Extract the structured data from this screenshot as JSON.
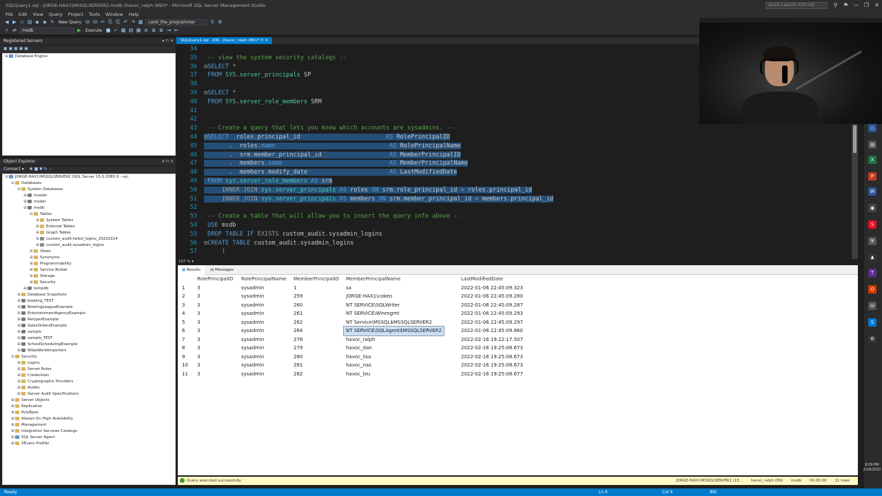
{
  "window": {
    "title": "SQLQuery1.sql - JORGE-HAX1\\MSSQLSERVER2.msdb (havoc_ralph (89))* - Microsoft SQL Server Management Studio",
    "quick_launch_placeholder": "Quick Launch (Ctrl+Q)",
    "buttons": [
      "⚲",
      "⚑",
      "—",
      "❐",
      "✕"
    ]
  },
  "menu": [
    "File",
    "Edit",
    "View",
    "Query",
    "Project",
    "Tools",
    "Window",
    "Help"
  ],
  "toolbar": {
    "new_query": "New Query",
    "database": "msdb",
    "execute": "Execute",
    "login": "carol_the_programmer"
  },
  "registered_servers": {
    "title": "Registered Servers",
    "pin_buttons": "▾ ⊓ ✕",
    "items": [
      {
        "label": "Database Engine"
      }
    ]
  },
  "object_explorer": {
    "title": "Object Explorer",
    "pin_buttons": "▾ ⊓ ✕",
    "connect_label": "Connect ▾",
    "nodes": [
      {
        "label": "JORGE-HAX1\\MSSQLSERVER2 (SQL Server 15.0.2080.9 - sa)",
        "exp": "⊟",
        "icon": "server",
        "indent": 0
      },
      {
        "label": "Databases",
        "exp": "⊟",
        "icon": "folder",
        "indent": 1
      },
      {
        "label": "System Databases",
        "exp": "⊟",
        "icon": "folder",
        "indent": 2
      },
      {
        "label": "master",
        "exp": "⊞",
        "icon": "db",
        "indent": 3
      },
      {
        "label": "model",
        "exp": "⊞",
        "icon": "db",
        "indent": 3
      },
      {
        "label": "msdb",
        "exp": "⊟",
        "icon": "db",
        "indent": 3
      },
      {
        "label": "Tables",
        "exp": "⊟",
        "icon": "folder",
        "indent": 4
      },
      {
        "label": "System Tables",
        "exp": "⊞",
        "icon": "folder",
        "indent": 5
      },
      {
        "label": "External Tables",
        "exp": "⊞",
        "icon": "folder",
        "indent": 5
      },
      {
        "label": "Graph Tables",
        "exp": "⊞",
        "icon": "folder",
        "indent": 5
      },
      {
        "label": "custom_audit.failed_logins_20220214",
        "exp": "⊞",
        "icon": "table",
        "indent": 5
      },
      {
        "label": "custom_audit.sysadmin_logins",
        "exp": "⊞",
        "icon": "table",
        "indent": 5
      },
      {
        "label": "Views",
        "exp": "⊞",
        "icon": "folder",
        "indent": 4
      },
      {
        "label": "Synonyms",
        "exp": "⊞",
        "icon": "folder",
        "indent": 4
      },
      {
        "label": "Programmability",
        "exp": "⊞",
        "icon": "folder",
        "indent": 4
      },
      {
        "label": "Service Broker",
        "exp": "⊞",
        "icon": "folder",
        "indent": 4
      },
      {
        "label": "Storage",
        "exp": "⊞",
        "icon": "folder",
        "indent": 4
      },
      {
        "label": "Security",
        "exp": "⊞",
        "icon": "folder",
        "indent": 4
      },
      {
        "label": "tempdb",
        "exp": "⊞",
        "icon": "db",
        "indent": 3
      },
      {
        "label": "Database Snapshots",
        "exp": "⊞",
        "icon": "folder",
        "indent": 2
      },
      {
        "label": "bowling_TEST",
        "exp": "⊞",
        "icon": "db",
        "indent": 2
      },
      {
        "label": "BowlingLeagueExample",
        "exp": "⊞",
        "icon": "db",
        "indent": 2
      },
      {
        "label": "EntertainmentAgencyExample",
        "exp": "⊞",
        "icon": "db",
        "indent": 2
      },
      {
        "label": "RecipesExample",
        "exp": "⊞",
        "icon": "db",
        "indent": 2
      },
      {
        "label": "SalesOrdersExample",
        "exp": "⊞",
        "icon": "db",
        "indent": 2
      },
      {
        "label": "sample",
        "exp": "⊞",
        "icon": "db",
        "indent": 2
      },
      {
        "label": "sample_TEST",
        "exp": "⊞",
        "icon": "db",
        "indent": 2
      },
      {
        "label": "SchoolSchedulingExample",
        "exp": "⊞",
        "icon": "db",
        "indent": 2
      },
      {
        "label": "WideWorldImporters",
        "exp": "⊞",
        "icon": "db",
        "indent": 2
      },
      {
        "label": "Security",
        "exp": "⊟",
        "icon": "folder",
        "indent": 1
      },
      {
        "label": "Logins",
        "exp": "⊞",
        "icon": "folder",
        "indent": 2
      },
      {
        "label": "Server Roles",
        "exp": "⊞",
        "icon": "folder",
        "indent": 2
      },
      {
        "label": "Credentials",
        "exp": "⊞",
        "icon": "folder",
        "indent": 2
      },
      {
        "label": "Cryptographic Providers",
        "exp": "⊞",
        "icon": "folder",
        "indent": 2
      },
      {
        "label": "Audits",
        "exp": "⊞",
        "icon": "folder",
        "indent": 2
      },
      {
        "label": "Server Audit Specifications",
        "exp": "⊞",
        "icon": "folder",
        "indent": 2
      },
      {
        "label": "Server Objects",
        "exp": "⊞",
        "icon": "folder",
        "indent": 1
      },
      {
        "label": "Replication",
        "exp": "⊞",
        "icon": "folder",
        "indent": 1
      },
      {
        "label": "PolyBase",
        "exp": "⊞",
        "icon": "folder",
        "indent": 1
      },
      {
        "label": "Always On High Availability",
        "exp": "⊞",
        "icon": "folder",
        "indent": 1
      },
      {
        "label": "Management",
        "exp": "⊞",
        "icon": "folder",
        "indent": 1
      },
      {
        "label": "Integration Services Catalogs",
        "exp": "⊞",
        "icon": "folder",
        "indent": 1
      },
      {
        "label": "SQL Server Agent",
        "exp": "⊞",
        "icon": "server",
        "indent": 1
      },
      {
        "label": "XEvent Profiler",
        "exp": "⊞",
        "icon": "folder",
        "indent": 1
      }
    ]
  },
  "editor": {
    "tab_label": "SQLQuery1.sql - JOR...(havoc_ralph (89))*  ⊓ ✕",
    "zoom": "107 % ▾",
    "lines": [
      {
        "num": "34",
        "parts": [
          {
            "t": "",
            "c": ""
          }
        ]
      },
      {
        "num": "35",
        "parts": [
          {
            "t": " -- view the system security catalogs --",
            "c": "cm"
          }
        ]
      },
      {
        "num": "36",
        "parts": [
          {
            "t": "⊟",
            "c": "gr"
          },
          {
            "t": "SELECT ",
            "c": "kw"
          },
          {
            "t": "*",
            "c": "gr"
          }
        ]
      },
      {
        "num": "37",
        "parts": [
          {
            "t": " FROM ",
            "c": "kw"
          },
          {
            "t": "SYS",
            "c": "sysobj"
          },
          {
            "t": ".",
            "c": "gr"
          },
          {
            "t": "server_principals",
            "c": "sysobj"
          },
          {
            "t": " SP",
            "c": "fn"
          }
        ]
      },
      {
        "num": "38",
        "parts": [
          {
            "t": "",
            "c": ""
          }
        ]
      },
      {
        "num": "39",
        "parts": [
          {
            "t": "⊟",
            "c": "gr"
          },
          {
            "t": "SELECT ",
            "c": "kw"
          },
          {
            "t": "*",
            "c": "gr"
          }
        ]
      },
      {
        "num": "40",
        "parts": [
          {
            "t": " FROM ",
            "c": "kw"
          },
          {
            "t": "SYS",
            "c": "sysobj"
          },
          {
            "t": ".",
            "c": "gr"
          },
          {
            "t": "server_role_members",
            "c": "sysobj"
          },
          {
            "t": " SRM",
            "c": "fn"
          }
        ]
      },
      {
        "num": "41",
        "parts": [
          {
            "t": "",
            "c": ""
          }
        ]
      },
      {
        "num": "42",
        "parts": [
          {
            "t": "",
            "c": ""
          }
        ]
      },
      {
        "num": "43",
        "parts": [
          {
            "t": " -- Create a query that lets you know which accounts are sysadmins. --",
            "c": "cm"
          }
        ]
      },
      {
        "num": "44",
        "hl": true,
        "parts": [
          {
            "t": "⊟",
            "c": "gr"
          },
          {
            "t": "SELECT",
            "c": "kw"
          },
          {
            "t": "  roles",
            "c": "fn"
          },
          {
            "t": ".",
            "c": "gr"
          },
          {
            "t": "principal_id",
            "c": "fn"
          },
          {
            "t": "                        ",
            "c": ""
          },
          {
            "t": "AS",
            "c": "kw"
          },
          {
            "t": " RolePrincipalID",
            "c": "fn"
          }
        ]
      },
      {
        "num": "45",
        "hl": true,
        "parts": [
          {
            "t": "       ,  ",
            "c": "gr"
          },
          {
            "t": "roles",
            "c": "fn"
          },
          {
            "t": ".",
            "c": "gr"
          },
          {
            "t": "name",
            "c": "kw"
          },
          {
            "t": "                                ",
            "c": ""
          },
          {
            "t": "AS",
            "c": "kw"
          },
          {
            "t": " RolePrincipalName",
            "c": "fn"
          }
        ]
      },
      {
        "num": "46",
        "hl": true,
        "parts": [
          {
            "t": "       ,  ",
            "c": "gr"
          },
          {
            "t": "srm",
            "c": "fn"
          },
          {
            "t": ".",
            "c": "gr"
          },
          {
            "t": "member_principal_id",
            "c": "fn"
          },
          {
            "t": "                   ",
            "c": ""
          },
          {
            "t": "AS",
            "c": "kw"
          },
          {
            "t": " MemberPrincipalID",
            "c": "fn"
          }
        ]
      },
      {
        "num": "47",
        "hl": true,
        "parts": [
          {
            "t": "       ,  ",
            "c": "gr"
          },
          {
            "t": "members",
            "c": "fn"
          },
          {
            "t": ".",
            "c": "gr"
          },
          {
            "t": "name",
            "c": "kw"
          },
          {
            "t": "                              ",
            "c": ""
          },
          {
            "t": "AS",
            "c": "kw"
          },
          {
            "t": " MemberPrincipalName",
            "c": "fn"
          }
        ]
      },
      {
        "num": "48",
        "hl": true,
        "parts": [
          {
            "t": "       ,  ",
            "c": "gr"
          },
          {
            "t": "members",
            "c": "fn"
          },
          {
            "t": ".",
            "c": "gr"
          },
          {
            "t": "modify_date",
            "c": "fn"
          },
          {
            "t": "                       ",
            "c": ""
          },
          {
            "t": "AS",
            "c": "kw"
          },
          {
            "t": " LastModifiedDate",
            "c": "fn"
          }
        ]
      },
      {
        "num": "49",
        "hl": true,
        "parts": [
          {
            "t": " FROM ",
            "c": "kw"
          },
          {
            "t": "sys",
            "c": "sysobj"
          },
          {
            "t": ".",
            "c": "gr"
          },
          {
            "t": "server_role_members",
            "c": "sysobj"
          },
          {
            "t": " AS",
            "c": "kw"
          },
          {
            "t": " srm",
            "c": "fn"
          }
        ]
      },
      {
        "num": "50",
        "hl": true,
        "parts": [
          {
            "t": "     INNER JOIN ",
            "c": "gr"
          },
          {
            "t": "sys",
            "c": "sysobj"
          },
          {
            "t": ".",
            "c": "gr"
          },
          {
            "t": "server_principals",
            "c": "sysobj"
          },
          {
            "t": " AS",
            "c": "kw"
          },
          {
            "t": " roles ",
            "c": "fn"
          },
          {
            "t": "ON",
            "c": "kw"
          },
          {
            "t": " srm",
            "c": "fn"
          },
          {
            "t": ".",
            "c": "gr"
          },
          {
            "t": "role_principal_id",
            "c": "fn"
          },
          {
            "t": " = ",
            "c": "gr"
          },
          {
            "t": "roles",
            "c": "fn"
          },
          {
            "t": ".",
            "c": "gr"
          },
          {
            "t": "principal_id",
            "c": "fn"
          }
        ]
      },
      {
        "num": "51",
        "hl": true,
        "parts": [
          {
            "t": "     INNER JOIN ",
            "c": "gr"
          },
          {
            "t": "sys",
            "c": "sysobj"
          },
          {
            "t": ".",
            "c": "gr"
          },
          {
            "t": "server_principals",
            "c": "sysobj"
          },
          {
            "t": " AS",
            "c": "kw"
          },
          {
            "t": " members ",
            "c": "fn"
          },
          {
            "t": "ON",
            "c": "kw"
          },
          {
            "t": " srm",
            "c": "fn"
          },
          {
            "t": ".",
            "c": "gr"
          },
          {
            "t": "member_principal_id",
            "c": "fn"
          },
          {
            "t": " = ",
            "c": "gr"
          },
          {
            "t": "members",
            "c": "fn"
          },
          {
            "t": ".",
            "c": "gr"
          },
          {
            "t": "principal_id",
            "c": "fn"
          }
        ]
      },
      {
        "num": "52",
        "parts": [
          {
            "t": "",
            "c": ""
          }
        ]
      },
      {
        "num": "53",
        "parts": [
          {
            "t": " -- Create a table that will allow you to insert the query info above --",
            "c": "cm"
          }
        ]
      },
      {
        "num": "54",
        "parts": [
          {
            "t": " USE ",
            "c": "kw"
          },
          {
            "t": "msdb",
            "c": "fn"
          }
        ]
      },
      {
        "num": "55",
        "parts": [
          {
            "t": " DROP TABLE IF ",
            "c": "kw"
          },
          {
            "t": "EXISTS",
            "c": "gr"
          },
          {
            "t": " custom_audit",
            "c": "fn"
          },
          {
            "t": ".",
            "c": "gr"
          },
          {
            "t": "sysadmin_logins",
            "c": "fn"
          }
        ]
      },
      {
        "num": "56",
        "parts": [
          {
            "t": "⊟",
            "c": "gr"
          },
          {
            "t": "CREATE TABLE ",
            "c": "kw"
          },
          {
            "t": "custom_audit",
            "c": "fn"
          },
          {
            "t": ".",
            "c": "gr"
          },
          {
            "t": "sysadmin_logins",
            "c": "fn"
          }
        ]
      },
      {
        "num": "57",
        "parts": [
          {
            "t": "     (",
            "c": "gr"
          }
        ]
      }
    ]
  },
  "results": {
    "tabs": [
      "Results",
      "Messages"
    ],
    "columns": [
      "RolePrincipalID",
      "RolePrincipalName",
      "MemberPrincipalID",
      "MemberPrincipalName",
      "LastModifiedDate"
    ],
    "rows": [
      [
        "1",
        "3",
        "sysadmin",
        "1",
        "sa",
        "2022-01-06 22:45:09.323"
      ],
      [
        "2",
        "3",
        "sysadmin",
        "259",
        "JORGE-HAX1\\cokeo",
        "2022-01-06 22:45:09.280"
      ],
      [
        "3",
        "3",
        "sysadmin",
        "260",
        "NT SERVICE\\SQLWriter",
        "2022-01-06 22:45:09.287"
      ],
      [
        "4",
        "3",
        "sysadmin",
        "261",
        "NT SERVICE\\Winmgmt",
        "2022-01-06 22:45:09.293"
      ],
      [
        "5",
        "3",
        "sysadmin",
        "262",
        "NT Service\\MSSQL$MSSQLSERVER2",
        "2022-01-06 22:45:09.297"
      ],
      [
        "6",
        "3",
        "sysadmin",
        "264",
        "NT SERVICE\\SQLAgent$MSSQLSERVER2",
        "2022-01-06 22:45:09.860"
      ],
      [
        "7",
        "3",
        "sysadmin",
        "278",
        "havoc_ralph",
        "2022-02-16 19:22:17.507"
      ],
      [
        "8",
        "3",
        "sysadmin",
        "279",
        "havoc_dan",
        "2022-02-16 19:25:08.673"
      ],
      [
        "9",
        "3",
        "sysadmin",
        "280",
        "havoc_lisa",
        "2022-02-16 19:25:08.673"
      ],
      [
        "10",
        "3",
        "sysadmin",
        "281",
        "havoc_nas",
        "2022-02-16 19:25:08.673"
      ],
      [
        "11",
        "3",
        "sysadmin",
        "282",
        "havoc_lou",
        "2022-02-16 19:25:08.677"
      ]
    ]
  },
  "query_status": {
    "message": "Query executed successfully.",
    "server": "JORGE-HAX1\\MSSQLSERVER2 (15...",
    "user": "havoc_ralph (89)",
    "db": "msdb",
    "time": "00:00:00",
    "rows": "11 rows"
  },
  "statusbar": {
    "ready": "Ready",
    "ln": "Ln 6",
    "col": "Col 4",
    "ins": "INS"
  },
  "taskbar": {
    "time": "8:59 PM",
    "date": "2/16/2022"
  },
  "colors": {
    "accent": "#007acc",
    "keyword": "#569cd6",
    "comment": "#57a64a",
    "line_number": "#2b91af",
    "selection": "#264f78"
  }
}
